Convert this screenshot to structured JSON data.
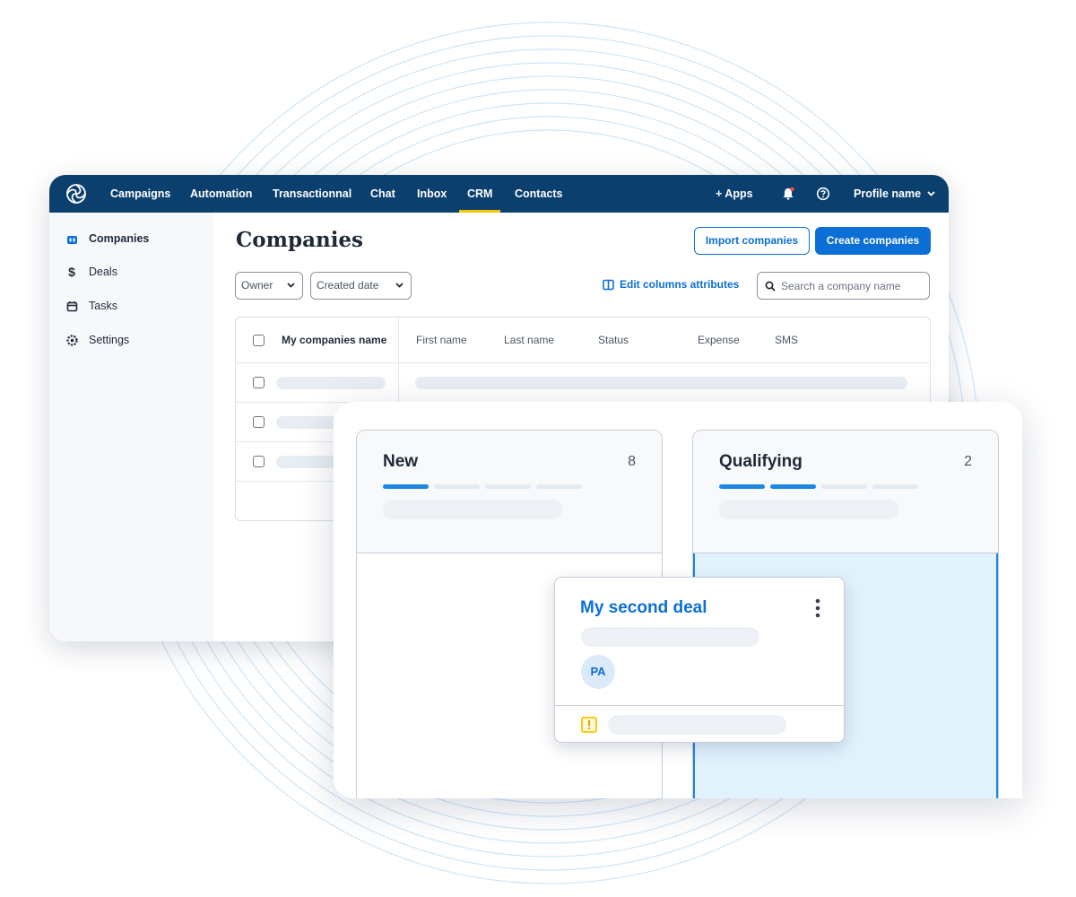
{
  "topnav": {
    "items": [
      "Campaigns",
      "Automation",
      "Transactionnal",
      "Chat",
      "Inbox",
      "CRM",
      "Contacts"
    ],
    "active": "CRM",
    "apps_label": "+ Apps",
    "profile_label": "Profile name",
    "icons": [
      "brand-logo-icon",
      "bell-icon",
      "help-icon",
      "chevron-down-icon"
    ]
  },
  "sidebar": {
    "items": [
      {
        "label": "Companies",
        "icon": "building-icon"
      },
      {
        "label": "Deals",
        "icon": "dollar-icon"
      },
      {
        "label": "Tasks",
        "icon": "calendar-icon"
      },
      {
        "label": "Settings",
        "icon": "gear-icon"
      }
    ],
    "active": "Companies"
  },
  "main": {
    "title": "Companies",
    "import_label": "Import companies",
    "create_label": "Create companies",
    "filters": {
      "owner": "Owner",
      "created_date": "Created date"
    },
    "edit_columns_label": "Edit columns attributes",
    "search_placeholder": "Search a company name",
    "table": {
      "headers": [
        "My companies name",
        "First name",
        "Last name",
        "Status",
        "Expense",
        "SMS"
      ]
    }
  },
  "board": {
    "columns": [
      {
        "title": "New",
        "count": "8",
        "progress_filled": 1,
        "progress_total": 4
      },
      {
        "title": "Qualifying",
        "count": "2",
        "progress_filled": 2,
        "progress_total": 4
      }
    ],
    "deal": {
      "title": "My second deal",
      "avatar_initials": "PA",
      "icons": [
        "kebab-menu-icon",
        "warning-icon"
      ]
    }
  },
  "colors": {
    "nav_bg": "#0b3f6e",
    "accent": "#0b6fd6",
    "active_indicator": "#f6c700",
    "drop_zone": "#e2f2fd",
    "warning": "#f6c700"
  }
}
